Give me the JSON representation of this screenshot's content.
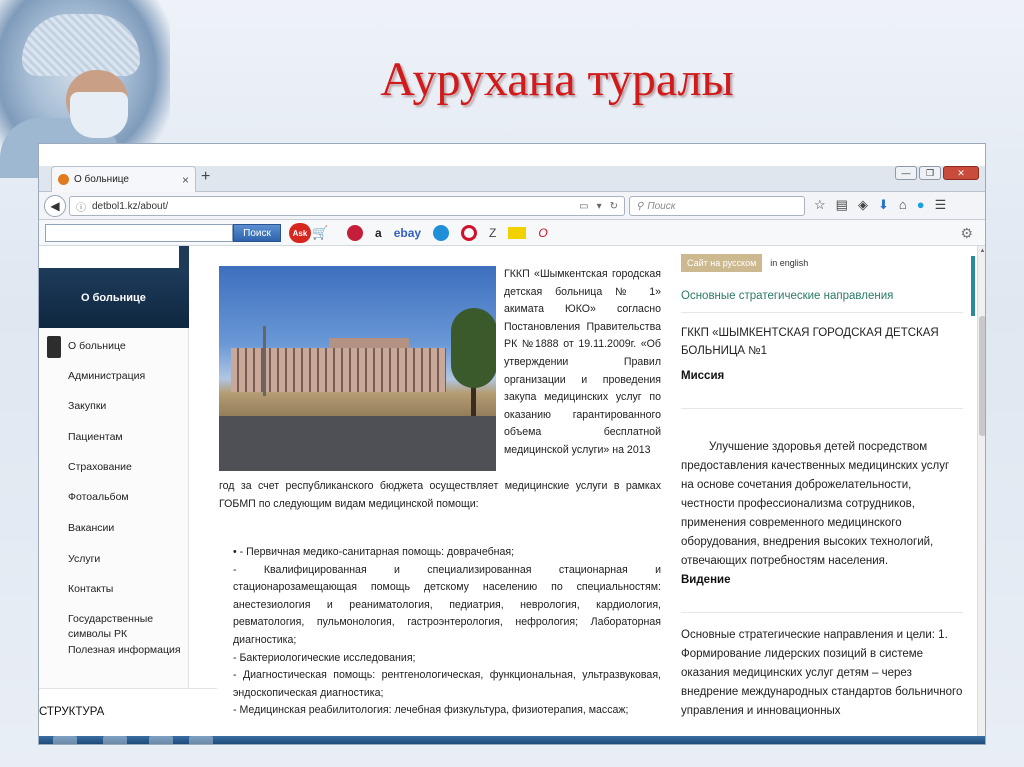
{
  "slide": {
    "title": "Аурухана туралы"
  },
  "browser": {
    "tab": {
      "title": "О больнице",
      "close": "×",
      "new_tab": "+"
    },
    "window_buttons": {
      "minimize": "—",
      "maximize": "❐",
      "close": "✕"
    },
    "url": "detbol1.kz/about/",
    "search_placeholder": "Поиск",
    "toolbar2": {
      "search_button": "Поиск",
      "ask_logo": "Ask",
      "site_icons": [
        "a",
        "ebay",
        "Z",
        "O"
      ]
    }
  },
  "page": {
    "sidebar": {
      "header": "О больнице",
      "items": [
        "О больнице",
        "Администрация",
        "Закупки",
        "Пациентам",
        "Страхование",
        "Фотоальбом",
        "Вакансии",
        "Услуги",
        "Контакты",
        "Государственные",
        "символы РК",
        "Полезная информация"
      ],
      "bottom_label": "СТРУКТУРА"
    },
    "intro": {
      "text_beside_photo": "ГККП «Шымкентская городская детская больница № 1» акимата ЮКО» согласно Постановления Правительства РК №1888 от 19.11.2009г. «Об утверждении Правил организации и проведения закупа медицинских услуг по оказанию гарантированного объема бесплатной медицинской услуги» на 2013",
      "text_below_photo": "год за счет республиканского бюджета осуществляет медицинские услуги в рамках ГОБМП по следующим видам медицинской помощи:"
    },
    "services": [
      "• - Первичная медико-санитарная помощь: доврачебная;",
      "- Квалифицированная и специализированная стационарная и стационарозамещающая помощь детскому населению по специальностям: анестезиология и реаниматология, педиатрия, неврология, кардиология, ревматология, пульмонология, гастроэнтерология, нефрология; Лабораторная диагностика;",
      "- Бактериологические исследования;",
      "- Диагностическая помощь: рентгенологическая, функциональная, ультразвуковая, эндоскопическая диагностика;",
      "- Медицинская реабилитология: лечебная физкультура, физиотерапия, массаж;"
    ],
    "right": {
      "lang_ru": "Сайт на русском",
      "lang_en": "in english",
      "strategy_link": "Основные стратегические направления",
      "org_name": "ГККП «ШЫМКЕНТСКАЯ ГОРОДСКАЯ ДЕТСКАЯ БОЛЬНИЦА №1",
      "mission_heading": "Миссия",
      "mission_text": "Улучшение здоровья   детей посредством предоставления качественных медицинских услуг на основе сочетания  доброжелательности, честности профессионализма сотрудников, применения современного медицинского оборудования, внедрения высоких технологий, отвечающих потребностям населения.",
      "vision_heading": "Видение",
      "goals_text": "Основные стратегические направления и цели: 1. Формирование лидерских позиций в системе оказания медицинских услуг  детям – через внедрение международных стандартов больничного управления и инновационных"
    }
  },
  "colors": {
    "title_red": "#d11a1a",
    "sidebar_header": "#1e3b5a",
    "link_green": "#2a7a66",
    "lang_ru_bg": "#cdb98f"
  }
}
